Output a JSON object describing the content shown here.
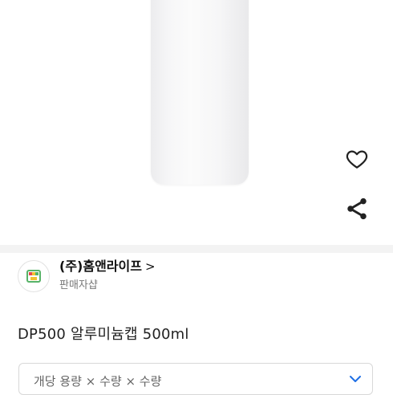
{
  "seller": {
    "name": "(주)홈앤라이프",
    "chevron": ">",
    "subtitle": "판매자샵"
  },
  "product": {
    "title": "DP500 알루미늄캡 500ml"
  },
  "option_select": {
    "placeholder": "개당 용량 × 수량 × 수량"
  },
  "icons": {
    "wishlist": "heart-outline-icon",
    "share": "share-icon",
    "seller_logo": "shop-logo-icon",
    "dropdown": "chevron-down-icon"
  },
  "colors": {
    "accent": "#1f6fe5",
    "logo_green": "#58b368",
    "logo_yellow": "#f2c230",
    "logo_red": "#e5484d"
  }
}
